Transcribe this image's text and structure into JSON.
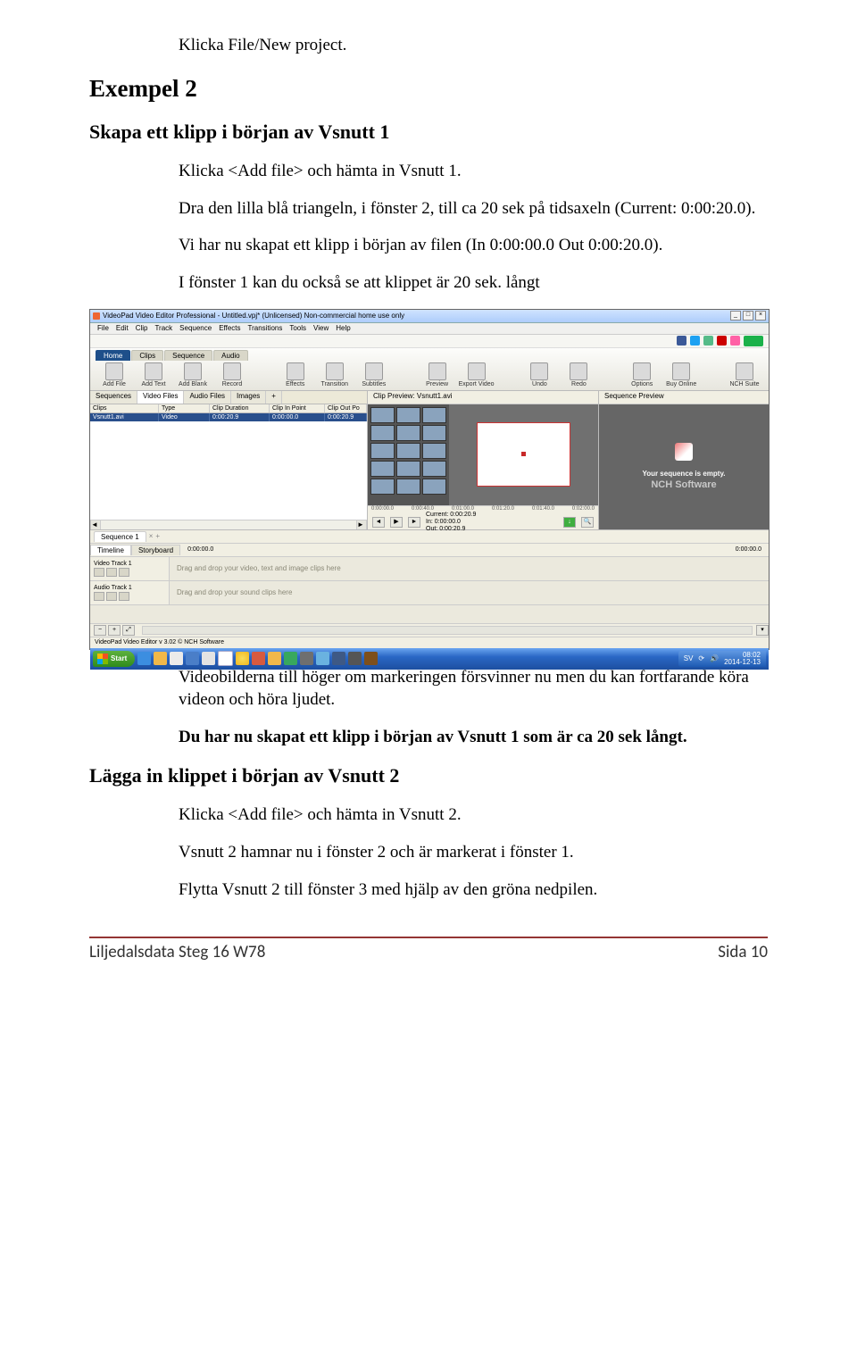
{
  "doc": {
    "topline": "Klicka File/New project.",
    "h_exempel": "Exempel 2",
    "h_skapa": "Skapa ett klipp i början av Vsnutt 1",
    "p_add1": "Klicka <Add file> och hämta in Vsnutt 1.",
    "p_drag": "Dra den lilla blå triangeln, i fönster 2, till ca 20 sek på tidsaxeln (Current: 0:00:20.0).",
    "p_skapat": "Vi har nu skapat ett klipp i början av filen (In 0:00:00.0 Out 0:00:20.0).",
    "p_fonster": "I fönster 1 kan du också se att klippet är 20 sek. långt",
    "p_video": "Videobilderna till höger om markeringen försvinner nu men du kan fortfarande köra videon och höra ljudet.",
    "p_bold": "Du har nu skapat ett klipp i början av Vsnutt 1 som är ca 20 sek långt.",
    "h_lagga": "Lägga in klippet i början av Vsnutt 2",
    "p_add2": "Klicka <Add file> och hämta in Vsnutt 2.",
    "p_v2": "Vsnutt 2 hamnar nu i fönster 2 och är markerat i fönster 1.",
    "p_flytta": "Flytta Vsnutt 2 till fönster 3 med hjälp av den gröna nedpilen.",
    "footer_left": "Liljedalsdata Steg 16 W78",
    "footer_right": "Sida 10"
  },
  "shot": {
    "title": "VideoPad Video Editor Professional - Untitled.vpj* (Unlicensed) Non-commercial home use only",
    "menu": [
      "File",
      "Edit",
      "Clip",
      "Track",
      "Sequence",
      "Effects",
      "Transitions",
      "Tools",
      "View",
      "Help"
    ],
    "ribbon_tabs": [
      "Home",
      "Clips",
      "Sequence",
      "Audio"
    ],
    "ribbon_buttons_left": [
      "Add File",
      "Add Text",
      "Add Blank",
      "Record"
    ],
    "ribbon_buttons_mid1": [
      "Effects",
      "Transition",
      "Subtitles"
    ],
    "ribbon_buttons_mid2": [
      "Preview",
      "Export Video"
    ],
    "ribbon_buttons_mid3": [
      "Undo",
      "Redo"
    ],
    "ribbon_buttons_right": [
      "Options",
      "Buy Online"
    ],
    "ribbon_nch": "NCH Suite",
    "palette_tabs": [
      "Sequences",
      "Video Files",
      "Audio Files",
      "Images",
      "+"
    ],
    "clip_headers": [
      "Clips",
      "Type",
      "Clip Duration",
      "Clip In Point",
      "Clip Out Po"
    ],
    "clip_row": [
      "Vsnutt1.avi",
      "Video",
      "0:00:20.9",
      "0:00:00.0",
      "0:00:20.9"
    ],
    "preview_title": "Clip Preview: Vsnutt1.avi",
    "ruler": [
      "0:00:00.0",
      "0:00:40.0",
      "0:01:00.0",
      "0:01:20.0",
      "0:01:40.0",
      "0:02:00.0"
    ],
    "pvinfo_labels": [
      "Current:",
      "In:",
      "Out:"
    ],
    "pvinfo_vals": [
      "0:00:20.9",
      "0:00:00.0",
      "0:00:20.9"
    ],
    "seq_title": "Sequence Preview",
    "seq_empty": "Your sequence is empty.",
    "nch_soft": "NCH Software",
    "seq_tab": "Sequence 1",
    "tl_modes": [
      "Timeline",
      "Storyboard"
    ],
    "tl_time_left": "0:00:00.0",
    "tl_time_right": "0:00:00.0",
    "track_video": "Video Track 1",
    "drop_video": "Drag and drop your video, text and image clips here",
    "track_audio": "Audio Track 1",
    "drop_audio": "Drag and drop your sound clips here",
    "status": "VideoPad Video Editor v 3.02 © NCH Software",
    "start": "Start",
    "tray_lang": "SV",
    "tray_time": "08:02",
    "tray_date": "2014-12-13"
  }
}
